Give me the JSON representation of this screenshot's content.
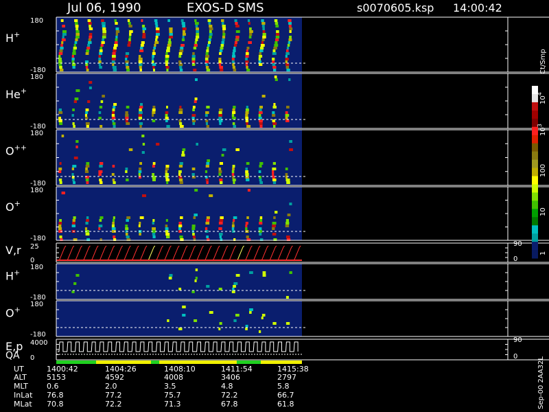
{
  "header": {
    "date": "Jul 06, 1990",
    "instrument": "EXOS-D SMS",
    "file": "s0070605.ksp",
    "time": "14:00:42"
  },
  "colors": {
    "background": "#000000",
    "plot_background": "#0a1e6e",
    "axis": "#ffffff",
    "dashed_ref": "#ffffff",
    "vr_trace": "#ff3030",
    "ep_trace": "#ffffff",
    "qa_good": "#20d020",
    "qa_mid": "#f0f000"
  },
  "chart_data": [
    {
      "type": "heatmap",
      "name": "H+",
      "label_base": "H",
      "label_sup": "+",
      "ylim": [
        -180,
        180
      ],
      "ytick_labels": [
        "180",
        "-180"
      ]
    },
    {
      "type": "heatmap",
      "name": "He+",
      "label_base": "He",
      "label_sup": "+",
      "ylim": [
        -180,
        180
      ],
      "ytick_labels": [
        "180",
        "-180"
      ]
    },
    {
      "type": "heatmap",
      "name": "O++",
      "label_base": "O",
      "label_sup": "++",
      "ylim": [
        -180,
        180
      ],
      "ytick_labels": [
        "180",
        "-180"
      ]
    },
    {
      "type": "heatmap",
      "name": "O+",
      "label_base": "O",
      "label_sup": "+",
      "ylim": [
        -180,
        180
      ],
      "ytick_labels": [
        "180",
        "-180"
      ]
    },
    {
      "type": "line",
      "name": "V,r",
      "label_base": "V,r",
      "label_sup": "",
      "ylim": [
        0,
        25
      ],
      "ytick_labels": [
        "25",
        "0"
      ],
      "right_tick_labels": [
        "90",
        "0"
      ]
    },
    {
      "type": "heatmap",
      "name": "H+ (lower)",
      "label_base": "H",
      "label_sup": "+",
      "ylim": [
        -180,
        180
      ],
      "ytick_labels": [
        "180",
        "-180"
      ]
    },
    {
      "type": "heatmap",
      "name": "O+ (lower)",
      "label_base": "O",
      "label_sup": "+",
      "ylim": [
        -180,
        180
      ],
      "ytick_labels": [
        "180",
        "-180"
      ]
    },
    {
      "type": "line",
      "name": "E,p QA",
      "label_base": "E,p",
      "label_sup": "",
      "label2": "QA",
      "ylim": [
        0,
        4000
      ],
      "ytick_labels": [
        "4000",
        "0"
      ],
      "right_tick_labels": [
        "90",
        "0"
      ]
    }
  ],
  "colorbar": {
    "title": "Ct/Smp",
    "labels": [
      {
        "base": "10",
        "exp": "4"
      },
      {
        "base": "10",
        "exp": "3"
      },
      {
        "base": "100",
        "exp": ""
      },
      {
        "base": "10",
        "exp": ""
      },
      {
        "base": "1",
        "exp": ""
      }
    ],
    "colors": [
      "#ffffff",
      "#e8e8e8",
      "#c01010",
      "#a00000",
      "#800000",
      "#ff2020",
      "#e02000",
      "#7a5a00",
      "#8a7a10",
      "#a09a20",
      "#c0b000",
      "#ffff00",
      "#d0ff00",
      "#80e000",
      "#40c000",
      "#00a000",
      "#007a00",
      "#00c0c0",
      "#00a0a0",
      "#0a1e6e",
      "#081a60"
    ]
  },
  "footer": {
    "row_labels": [
      "UT",
      "ALT",
      "MLT",
      "InLat",
      "MLat"
    ],
    "columns": [
      {
        "values": [
          "1400:42",
          "5153",
          "0.6",
          "76.8",
          "70.8"
        ]
      },
      {
        "values": [
          "1404:26",
          "4592",
          "2.0",
          "77.2",
          "72.2"
        ]
      },
      {
        "values": [
          "1408:10",
          "4008",
          "3.5",
          "75.7",
          "71.3"
        ]
      },
      {
        "values": [
          "1411:54",
          "3406",
          "4.8",
          "72.2",
          "67.8"
        ]
      },
      {
        "values": [
          "1415:38",
          "2797",
          "5.8",
          "66.7",
          "61.8"
        ]
      }
    ]
  },
  "side_label": "Sep-00  2AA32L"
}
